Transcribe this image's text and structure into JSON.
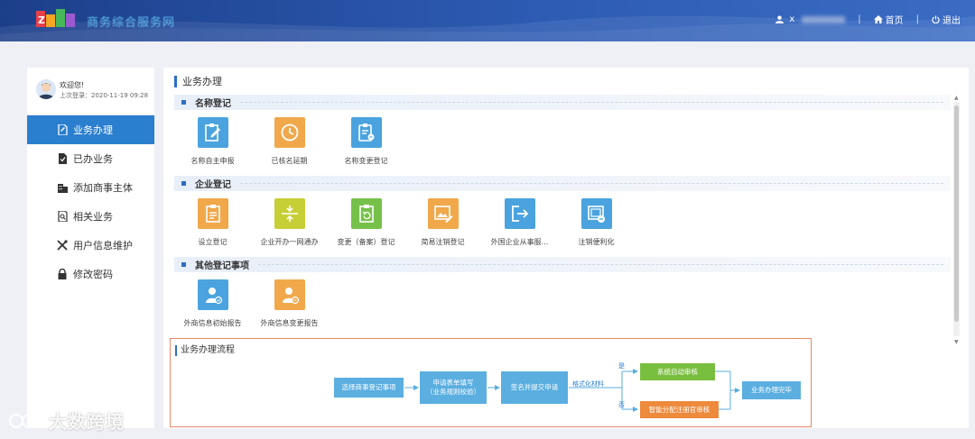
{
  "header": {
    "logo_text": "Z",
    "site_title": "商务综合服务网",
    "user_name": "x",
    "home_label": "首页",
    "logout_label": "退出"
  },
  "sidebar": {
    "welcome": "欢迎您!",
    "last_login": "上次登录：2020-11-19 09:28",
    "items": [
      {
        "label": "业务办理",
        "icon": "file-edit-icon",
        "active": true
      },
      {
        "label": "已办业务",
        "icon": "done-file-icon",
        "active": false
      },
      {
        "label": "添加商事主体",
        "icon": "building-icon",
        "active": false
      },
      {
        "label": "相关业务",
        "icon": "search-doc-icon",
        "active": false
      },
      {
        "label": "用户信息维护",
        "icon": "wrench-icon",
        "active": false
      },
      {
        "label": "修改密码",
        "icon": "lock-icon",
        "active": false
      }
    ]
  },
  "main": {
    "title": "业务办理",
    "sections": [
      {
        "title": "名称登记",
        "tiles": [
          {
            "label": "名称自主申报",
            "color": "#4aa3df",
            "icon": "clipboard-pen-icon"
          },
          {
            "label": "已核名延期",
            "color": "#f0a84b",
            "icon": "clock-icon"
          },
          {
            "label": "名称变更登记",
            "color": "#4aa3df",
            "icon": "list-change-icon"
          }
        ]
      },
      {
        "title": "企业登记",
        "tiles": [
          {
            "label": "设立登记",
            "color": "#f0a84b",
            "icon": "document-icon"
          },
          {
            "label": "企业开办一网通办",
            "color": "#c7cf36",
            "icon": "merge-icon"
          },
          {
            "label": "变更（备案）登记",
            "color": "#76c14a",
            "icon": "refresh-doc-icon"
          },
          {
            "label": "简易注销登记",
            "color": "#f0a84b",
            "icon": "image-edit-icon"
          },
          {
            "label": "外国企业从事服...",
            "color": "#4aa3df",
            "icon": "exit-icon"
          },
          {
            "label": "注销便利化",
            "color": "#4aa3df",
            "icon": "cancel-doc-icon"
          }
        ]
      },
      {
        "title": "其他登记事项",
        "tiles": [
          {
            "label": "外商信息初始报告",
            "color": "#4aa3df",
            "icon": "person-report-icon"
          },
          {
            "label": "外商信息变更报告",
            "color": "#f0a84b",
            "icon": "person-change-icon"
          }
        ]
      }
    ]
  },
  "flow": {
    "title": "业务办理流程",
    "step1": "选择商事登记事项",
    "step2a": "申请表单填写",
    "step2b": "（业务规则校验）",
    "step3": "签名并提交申请",
    "step_label": "格式化材料",
    "yes": "是",
    "no": "否",
    "auto_review": "系统自动审核",
    "manual_review": "智能分配注册官审核",
    "done": "业务办理完毕"
  },
  "watermark": "大数跨境"
}
